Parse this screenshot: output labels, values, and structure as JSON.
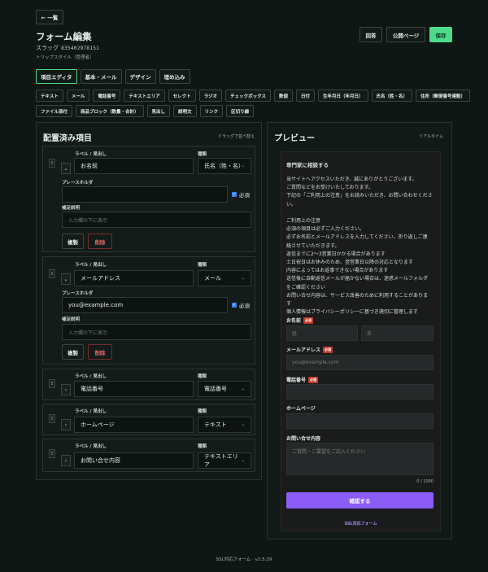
{
  "header": {
    "back_label": "← 一覧",
    "title": "フォーム編集",
    "slug_label": "スラッグ",
    "slug_value": "835402978151",
    "subtitle": "トリップスタイル（管理者）",
    "answers_label": "回答",
    "public_page_label": "公開ページ",
    "save_label": "保存"
  },
  "tabs": [
    "項目エディタ",
    "基本・メール",
    "デザイン",
    "埋め込み"
  ],
  "field_types_row1": [
    "テキスト",
    "メール",
    "電話番号",
    "テキストエリア",
    "セレクト",
    "ラジオ",
    "チェックボックス",
    "数値",
    "日付",
    "生年月日（年月日）",
    "氏名（姓・名）",
    "住所（郵便番号連動）"
  ],
  "field_types_row2": [
    "ファイル添付",
    "商品ブロック（数量・合計）",
    "見出し",
    "説明文",
    "リンク",
    "区切り線"
  ],
  "left_panel": {
    "title": "配置済み項目",
    "hint": "ドラッグで並べ替え",
    "label_caption": "ラベル / 見出し",
    "type_caption": "種類",
    "placeholder_caption": "プレースホルダ",
    "help_caption": "補足説明",
    "help_placeholder": "入力欄の下に表示",
    "required_label": "必須",
    "duplicate_label": "複製",
    "delete_label": "削除",
    "handle_glyph": "⠿",
    "expand_glyph": "⌄",
    "collapse_glyph": "›",
    "cards": [
      {
        "label": "お名前",
        "type": "氏名（姓・名）",
        "placeholder": ""
      },
      {
        "label": "メールアドレス",
        "type": "メール",
        "placeholder": "you@example.com"
      },
      {
        "label": "電話番号",
        "type": "電話番号"
      },
      {
        "label": "ホームページ",
        "type": "テキスト"
      },
      {
        "label": "お問い合せ内容",
        "type": "テキストエリア"
      }
    ]
  },
  "preview": {
    "title": "プレビュー",
    "hint": "リアルタイム",
    "heading": "専門家に相談する",
    "intro": [
      "当サイトへアクセスいただき、誠にありがとうございます。",
      "ご質問などをお受けいたしております。",
      "下記の「ご利用上の注意」をお読みいただき、お問い合わせくださ",
      "い。",
      "",
      "ご利用上の注意",
      "必須の項目は必ずご入力ください。",
      "必ずお名前とメールアドレスを入力してください。折り返しご連",
      "絡させていただきます。",
      "返信までに2～3営業日かかる場合があります",
      "土日祝日はお休みのため、翌営業日以降の対応となります",
      "内容によってはお返事できない場合があります",
      "送信後に自動返信メールが届かない場合は、迷惑メールフォルダ",
      "をご確認ください",
      "お問い合せ内容は、サービス改善のために利用することがありま",
      "す",
      "個人情報はプライバシーポリシーに基づき適切に管理します"
    ],
    "required_badge": "必須",
    "name_label": "お名前",
    "last_name_ph": "姓",
    "first_name_ph": "名",
    "email_label": "メールアドレス",
    "email_ph": "you@example.com",
    "tel_label": "電話番号",
    "homepage_label": "ホームページ",
    "inquiry_label": "お問い合せ内容",
    "inquiry_ph": "ご質問・ご要望をご記入ください",
    "counter": "0 / 1000",
    "submit_label": "確認する",
    "brand": "SSL対応フォーム"
  },
  "footer": "SSL対応フォーム · v2.5.29",
  "colors": {
    "accent": "#4ddb8a",
    "submit": "#8b5cf6",
    "danger": "#e36464"
  }
}
